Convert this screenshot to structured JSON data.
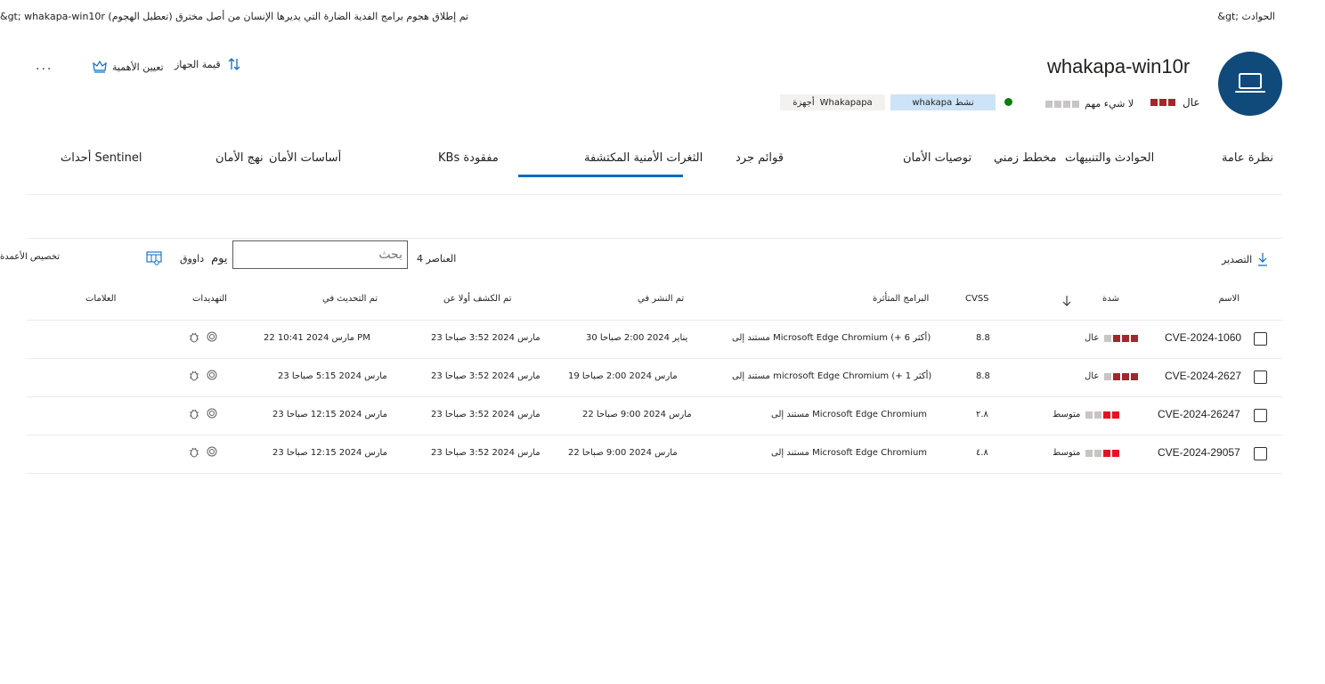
{
  "breadcrumb": {
    "left": "&gt; whakapa-win10r (تم إطلاق هجوم برامج الفدية الضارة التي يديرها الإنسان من أصل مخترق (تعطيل الهجوم",
    "right": "&gt; الحوادث"
  },
  "device": {
    "name": "whakapa-win10r",
    "risk_label": "عال",
    "exposure_label": "لا شيء مهم",
    "tag_active": "whakapa نشط",
    "tag_devices_label": "أجهزة",
    "tag_devices_value": "Whakapapa"
  },
  "actions": {
    "device_value": "قيمة الجهاز",
    "set_importance": "تعيين الأهمية",
    "more": "..."
  },
  "tabs": [
    {
      "label": "نظرة عامة"
    },
    {
      "label": "الحوادث والتنبيهات"
    },
    {
      "label": "مخطط زمني"
    },
    {
      "label": "توصيات الأمان"
    },
    {
      "label": "قوائم جرد"
    },
    {
      "label": "الثغرات الأمنية المكتشفة"
    },
    {
      "label": "KBs مفقودة"
    },
    {
      "label": "أساسات الأمان"
    },
    {
      "label": "نهج الأمان"
    },
    {
      "label": "أحداث Sentinel"
    }
  ],
  "toolbar": {
    "export": "التصدير",
    "item_count": "4 العناصر",
    "search_placeholder": "بحث",
    "period_unit": "يوم",
    "period_label": "داووق",
    "customize_columns": "تخصيص الأعمدة"
  },
  "table": {
    "headers": {
      "name": "الاسم",
      "severity": "شدة",
      "cvss": "CVSS",
      "related_software": "البرامج المتأثرة",
      "published_on": "تم النشر في",
      "first_detected": "تم الكشف أولا عن",
      "updated_on": "تم التحديث في",
      "threats": "التهديدات",
      "tags": "العلامات"
    },
    "rows": [
      {
        "name": "CVE-2024-1060",
        "severity": "عال",
        "cvss": "8.8",
        "software": "مستند إلى Microsoft Edge Chromium (+ 6 أكثر)",
        "published": "30 يناير 2024 2:00 صباحا",
        "first_detected": "23 مارس 2024 3:52 صباحا",
        "updated": "22 مارس 2024 10:41 PM"
      },
      {
        "name": "CVE-2024-2627",
        "severity": "عال",
        "cvss": "8.8",
        "software": "مستند إلى microsoft Edge Chromium (+ 1 أكثر)",
        "published": "19 مارس 2024 2:00 صباحا",
        "first_detected": "23 مارس 2024 3:52 صباحا",
        "updated": "23 مارس 2024 5:15 صباحا"
      },
      {
        "name": "CVE-2024-26247",
        "severity": "متوسط",
        "cvss": "٢.٨",
        "software": "مستند إلى Microsoft Edge Chromium",
        "published": "22 مارس 2024 9:00 صباحا",
        "first_detected": "23 مارس 2024 3:52 صباحا",
        "updated": "23 مارس 2024 12:15 صباحا"
      },
      {
        "name": "CVE-2024-29057",
        "severity": "متوسط",
        "cvss": "٤.٨",
        "software": "مستند إلى Microsoft Edge Chromium",
        "published": "22 مارس 2024 9:00 صباحا",
        "first_detected": "23 مارس 2024 3:52 صباحا",
        "updated": "23 مارس 2024 12:15 صباحا"
      }
    ]
  },
  "colors": {
    "accent": "#0f6cbd",
    "avatar": "#0f4a7a",
    "sev_high": "#a4262c",
    "sev_medium": "#e81123",
    "sev_empty": "#c8c6c4",
    "active_green": "#107c10"
  }
}
